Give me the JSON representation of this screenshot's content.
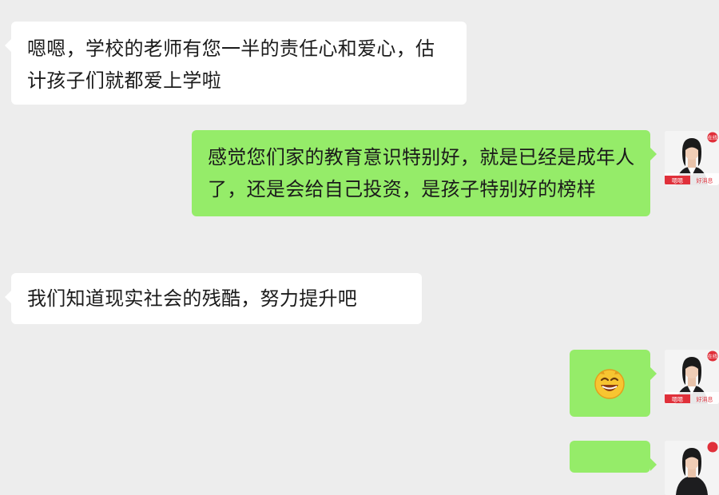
{
  "chat": {
    "messages": [
      {
        "side": "left",
        "text": "嗯嗯，学校的老师有您一半的责任心和爱心，估计孩子们就都爱上学啦"
      },
      {
        "side": "right",
        "text": "感觉您们家的教育意识特别好，就是已经是成年人了，还是会给自己投资，是孩子特别好的榜样"
      },
      {
        "side": "left",
        "text": "我们知道现实社会的残酷，努力提升吧"
      },
      {
        "side": "right",
        "emoji": "grinning-face"
      },
      {
        "side": "right",
        "text": ""
      }
    ]
  },
  "avatar": {
    "badge": "在线",
    "footer_left": "嗯嗯",
    "footer_right": "好消息"
  },
  "colors": {
    "background": "#ededed",
    "incoming_bubble": "#ffffff",
    "outgoing_bubble": "#95ec69",
    "avatar_accent": "#e0303a"
  }
}
